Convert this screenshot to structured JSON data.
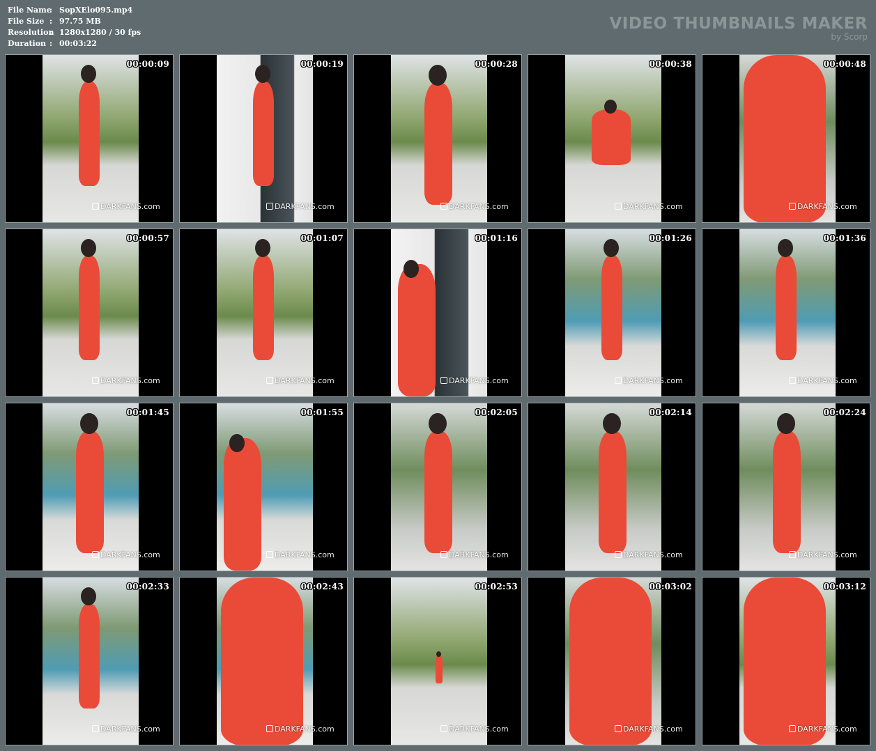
{
  "info": [
    {
      "key": "File Name",
      "sep": ":",
      "value": "SopXElo095.mp4"
    },
    {
      "key": "File Size",
      "sep": ":",
      "value": "97.75 MB"
    },
    {
      "key": "Resolution",
      "sep": ":",
      "value": "1280x1280 / 30 fps"
    },
    {
      "key": "Duration",
      "sep": ":",
      "value": "00:03:22"
    }
  ],
  "brand": {
    "title": "VIDEO THUMBNAILS MAKER",
    "subtitle": "by Scorp"
  },
  "watermark": "DARKFANS.com",
  "thumbnails": [
    {
      "time": "00:00:09",
      "scene": "garden",
      "figure": "walk"
    },
    {
      "time": "00:00:19",
      "scene": "house",
      "figure": "walk"
    },
    {
      "time": "00:00:28",
      "scene": "garden",
      "figure": "back"
    },
    {
      "time": "00:00:38",
      "scene": "garden",
      "figure": "crouch"
    },
    {
      "time": "00:00:48",
      "scene": "close",
      "figure": "closeup"
    },
    {
      "time": "00:00:57",
      "scene": "garden",
      "figure": "walk"
    },
    {
      "time": "00:01:07",
      "scene": "garden",
      "figure": "walk"
    },
    {
      "time": "00:01:16",
      "scene": "house",
      "figure": "side"
    },
    {
      "time": "00:01:26",
      "scene": "pool",
      "figure": "walk"
    },
    {
      "time": "00:01:36",
      "scene": "pool",
      "figure": "walk"
    },
    {
      "time": "00:01:45",
      "scene": "pool",
      "figure": "back"
    },
    {
      "time": "00:01:55",
      "scene": "pool",
      "figure": "side"
    },
    {
      "time": "00:02:05",
      "scene": "close",
      "figure": "back"
    },
    {
      "time": "00:02:14",
      "scene": "close",
      "figure": "back"
    },
    {
      "time": "00:02:24",
      "scene": "close",
      "figure": "back"
    },
    {
      "time": "00:02:33",
      "scene": "pool",
      "figure": "walk"
    },
    {
      "time": "00:02:43",
      "scene": "pool",
      "figure": "closeup"
    },
    {
      "time": "00:02:53",
      "scene": "garden",
      "figure": "far"
    },
    {
      "time": "00:03:02",
      "scene": "close",
      "figure": "closeup"
    },
    {
      "time": "00:03:12",
      "scene": "garden",
      "figure": "closeup"
    }
  ]
}
